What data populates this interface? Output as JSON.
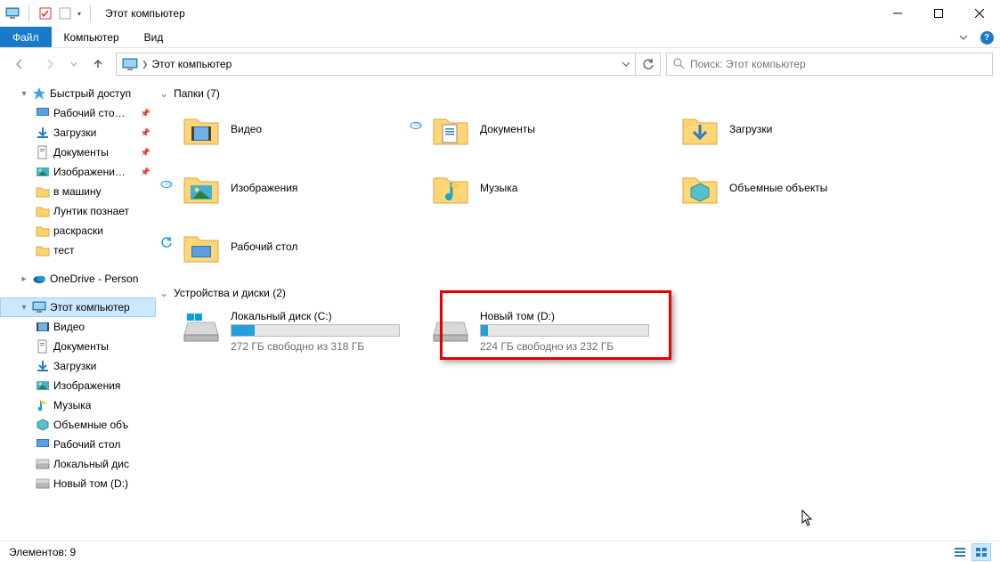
{
  "window": {
    "title": "Этот компьютер"
  },
  "ribbon": {
    "file": "Файл",
    "computer": "Компьютер",
    "view": "Вид"
  },
  "address": {
    "location": "Этот компьютер",
    "search_placeholder": "Поиск: Этот компьютер"
  },
  "sidebar": {
    "quick": "Быстрый доступ",
    "quick_items": [
      {
        "label": "Рабочий сто…",
        "pin": true
      },
      {
        "label": "Загрузки",
        "pin": true
      },
      {
        "label": "Документы",
        "pin": true
      },
      {
        "label": "Изображени…",
        "pin": true
      },
      {
        "label": "в машину"
      },
      {
        "label": "Лунтик познает"
      },
      {
        "label": "раскраски"
      },
      {
        "label": "тест"
      }
    ],
    "onedrive": "OneDrive - Person",
    "thispc": "Этот компьютер",
    "thispc_items": [
      {
        "label": "Видео"
      },
      {
        "label": "Документы"
      },
      {
        "label": "Загрузки"
      },
      {
        "label": "Изображения"
      },
      {
        "label": "Музыка"
      },
      {
        "label": "Объемные объ"
      },
      {
        "label": "Рабочий стол"
      },
      {
        "label": "Локальный дис"
      },
      {
        "label": "Новый том (D:)"
      }
    ]
  },
  "groups": {
    "folders": {
      "title": "Папки (7)",
      "items": [
        "Видео",
        "Документы",
        "Загрузки",
        "Изображения",
        "Музыка",
        "Объемные объекты",
        "Рабочий стол"
      ]
    },
    "drives": {
      "title": "Устройства и диски (2)",
      "items": [
        {
          "name": "Локальный диск (C:)",
          "free": "272 ГБ свободно из 318 ГБ",
          "pct": 14
        },
        {
          "name": "Новый том (D:)",
          "free": "224 ГБ свободно из 232 ГБ",
          "pct": 4
        }
      ]
    }
  },
  "status": {
    "text": "Элементов: 9"
  }
}
